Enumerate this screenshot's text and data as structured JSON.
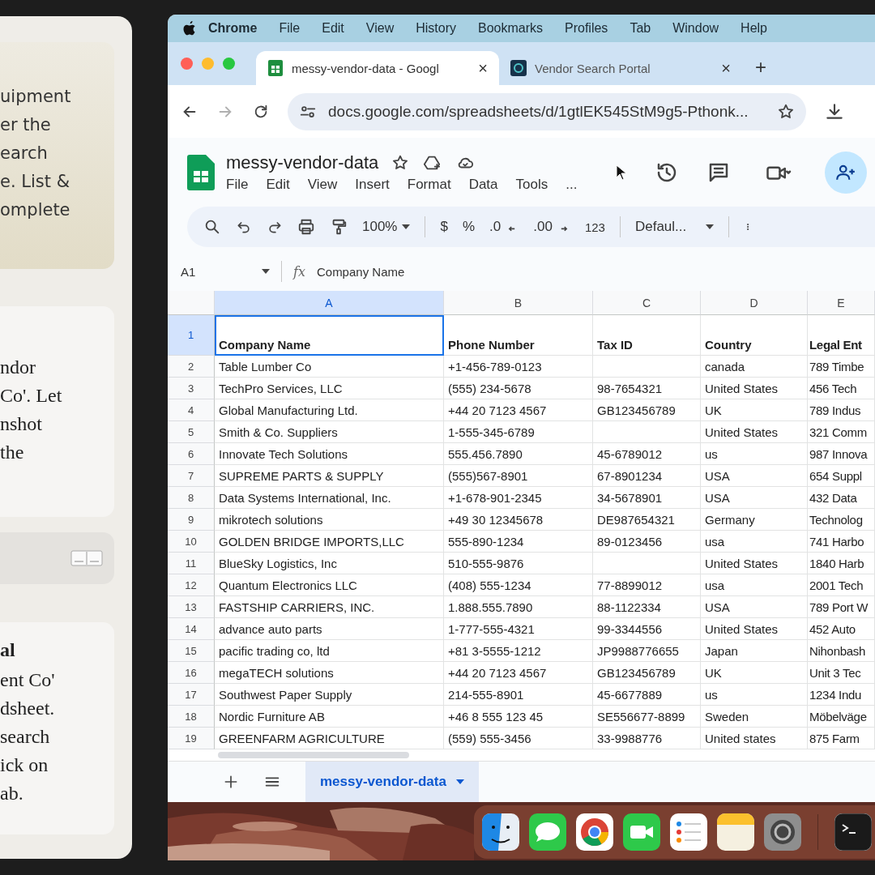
{
  "left_panel": {
    "cards": [
      {
        "kind": "highlight",
        "lines": [
          "uipment",
          "er the",
          "earch",
          "e. List &",
          "omplete"
        ]
      },
      {
        "kind": "message",
        "lines": [
          "ndor",
          "Co'. Let",
          "nshot",
          "the"
        ]
      },
      {
        "kind": "attachment"
      },
      {
        "kind": "message",
        "title": "al",
        "lines": [
          "ent Co'",
          "dsheet.",
          "search",
          "ick on",
          "ab."
        ]
      }
    ]
  },
  "menubar": {
    "app": "Chrome",
    "items": [
      "File",
      "Edit",
      "View",
      "History",
      "Bookmarks",
      "Profiles",
      "Tab",
      "Window",
      "Help"
    ]
  },
  "browser": {
    "tabs": [
      {
        "kind": "sheets",
        "title": "messy-vendor-data - Googl",
        "selected": true,
        "close": "×"
      },
      {
        "kind": "portal",
        "title": "Vendor Search Portal",
        "selected": false,
        "close": "×"
      }
    ],
    "new_tab": "+",
    "nav": [
      {
        "kind": "back",
        "disabled": false
      },
      {
        "kind": "forward",
        "disabled": true
      },
      {
        "kind": "reload",
        "disabled": false
      }
    ],
    "url": "docs.google.com/spreadsheets/d/1gtlEK545StM9g5-Pthonk..."
  },
  "sheet": {
    "title": "messy-vendor-data",
    "menus": [
      "File",
      "Edit",
      "View",
      "Insert",
      "Format",
      "Data",
      "Tools"
    ],
    "menu_more": "...",
    "zoom": "100%",
    "format_buttons": [
      {
        "kind": "currency",
        "label": "$"
      },
      {
        "kind": "percent",
        "label": "%"
      },
      {
        "kind": "decrease",
        "label": ".0"
      },
      {
        "kind": "increase",
        "label": ".00"
      },
      {
        "kind": "number",
        "label": "123"
      }
    ],
    "font": "Defaul...",
    "cell_ref": "A1",
    "fx": "fx",
    "formula": "Company Name",
    "columns": [
      {
        "label": "A",
        "selected": true
      },
      {
        "label": "B",
        "selected": false
      },
      {
        "label": "C",
        "selected": false
      },
      {
        "label": "D",
        "selected": false
      },
      {
        "label": "E",
        "selected": false
      }
    ],
    "rows": [
      {
        "number": "1",
        "selected": true,
        "kind": "header",
        "cells": [
          "Company Name",
          "Phone Number",
          "Tax ID",
          "Country",
          "Legal Ent"
        ]
      },
      {
        "number": "2",
        "selected": false,
        "kind": "data",
        "cells": [
          "Table Lumber Co",
          "+1-456-789-0123",
          null,
          "canada",
          "789 Timbe"
        ]
      },
      {
        "number": "3",
        "selected": false,
        "kind": "data",
        "cells": [
          "TechPro Services, LLC",
          "(555) 234-5678",
          "98-7654321",
          "United States",
          "456 Tech"
        ]
      },
      {
        "number": "4",
        "selected": false,
        "kind": "data",
        "cells": [
          "Global Manufacturing Ltd.",
          "+44 20 7123 4567",
          "GB123456789",
          "UK",
          "789 Indus"
        ]
      },
      {
        "number": "5",
        "selected": false,
        "kind": "data",
        "cells": [
          "Smith & Co. Suppliers",
          "1-555-345-6789",
          null,
          "United States",
          "321 Comm"
        ]
      },
      {
        "number": "6",
        "selected": false,
        "kind": "data",
        "cells": [
          "Innovate Tech Solutions",
          "555.456.7890",
          "45-6789012",
          "us",
          "987 Innova"
        ]
      },
      {
        "number": "7",
        "selected": false,
        "kind": "data",
        "cells": [
          "SUPREME PARTS & SUPPLY",
          "(555)567-8901",
          "67-8901234",
          "USA",
          "654 Suppl"
        ]
      },
      {
        "number": "8",
        "selected": false,
        "kind": "data",
        "cells": [
          "Data Systems International, Inc.",
          "+1-678-901-2345",
          "34-5678901",
          "USA",
          "432 Data"
        ]
      },
      {
        "number": "9",
        "selected": false,
        "kind": "data",
        "cells": [
          "mikrotech solutions",
          "+49 30 12345678",
          "DE987654321",
          "Germany",
          "Technolog"
        ]
      },
      {
        "number": "10",
        "selected": false,
        "kind": "data",
        "cells": [
          "GOLDEN BRIDGE IMPORTS,LLC",
          "555-890-1234",
          "89-0123456",
          "usa",
          "741 Harbo"
        ]
      },
      {
        "number": "11",
        "selected": false,
        "kind": "data",
        "cells": [
          "BlueSky Logistics, Inc",
          "510-555-9876",
          null,
          "United States",
          "1840 Harb"
        ]
      },
      {
        "number": "12",
        "selected": false,
        "kind": "data",
        "cells": [
          "Quantum Electronics LLC",
          "(408) 555-1234",
          "77-8899012",
          "usa",
          "2001 Tech"
        ]
      },
      {
        "number": "13",
        "selected": false,
        "kind": "data",
        "cells": [
          "FASTSHIP CARRIERS, INC.",
          "1.888.555.7890",
          "88-1122334",
          "USA",
          "789 Port W"
        ]
      },
      {
        "number": "14",
        "selected": false,
        "kind": "data",
        "cells": [
          "advance auto parts",
          "1-777-555-4321",
          "99-3344556",
          "United States",
          "452 Auto"
        ]
      },
      {
        "number": "15",
        "selected": false,
        "kind": "data",
        "cells": [
          "pacific trading co, ltd",
          "+81 3-5555-1212",
          "JP9988776655",
          "Japan",
          "Nihonbash"
        ]
      },
      {
        "number": "16",
        "selected": false,
        "kind": "data",
        "cells": [
          "megaTECH solutions",
          "+44 20 7123 4567",
          "GB123456789",
          "UK",
          "Unit 3 Tec"
        ]
      },
      {
        "number": "17",
        "selected": false,
        "kind": "data",
        "cells": [
          "Southwest Paper Supply",
          "214-555-8901",
          "45-6677889",
          "us",
          "1234 Indu"
        ]
      },
      {
        "number": "18",
        "selected": false,
        "kind": "data",
        "cells": [
          "Nordic Furniture AB",
          "+46 8 555 123 45",
          "SE556677-8899",
          "Sweden",
          "Möbelväge"
        ]
      },
      {
        "number": "19",
        "selected": false,
        "kind": "data",
        "cells": [
          "GREENFARM AGRICULTURE",
          "(559) 555-3456",
          "33-9988776",
          "United states",
          "875 Farm"
        ]
      }
    ],
    "sheet_tabs": [
      {
        "label": "messy-vendor-data",
        "selected": true
      }
    ]
  }
}
